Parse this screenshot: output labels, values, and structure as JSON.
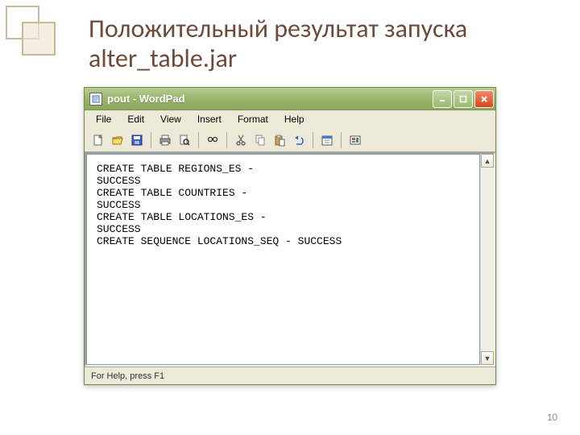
{
  "slide": {
    "title": "Положительный результат запуска alter_table.jar",
    "page_number": "10"
  },
  "window": {
    "title": "pout - WordPad",
    "min_label": "–",
    "max_label": "□",
    "close_label": "×",
    "status": "For Help, press F1"
  },
  "menu": {
    "items": [
      "File",
      "Edit",
      "View",
      "Insert",
      "Format",
      "Help"
    ]
  },
  "content": {
    "text": "CREATE TABLE REGIONS_ES -\nSUCCESS\nCREATE TABLE COUNTRIES -\nSUCCESS\nCREATE TABLE LOCATIONS_ES -\nSUCCESS\nCREATE SEQUENCE LOCATIONS_SEQ - SUCCESS"
  },
  "toolbar": {
    "icons": [
      {
        "name": "new-icon"
      },
      {
        "name": "open-icon"
      },
      {
        "name": "save-icon"
      },
      {
        "sep": true
      },
      {
        "name": "print-icon"
      },
      {
        "name": "preview-icon"
      },
      {
        "sep": true
      },
      {
        "name": "find-icon"
      },
      {
        "sep": true
      },
      {
        "name": "cut-icon"
      },
      {
        "name": "copy-icon"
      },
      {
        "name": "paste-icon"
      },
      {
        "name": "undo-icon"
      },
      {
        "sep": true
      },
      {
        "name": "date-icon"
      },
      {
        "sep": true
      },
      {
        "name": "object-icon"
      }
    ]
  }
}
